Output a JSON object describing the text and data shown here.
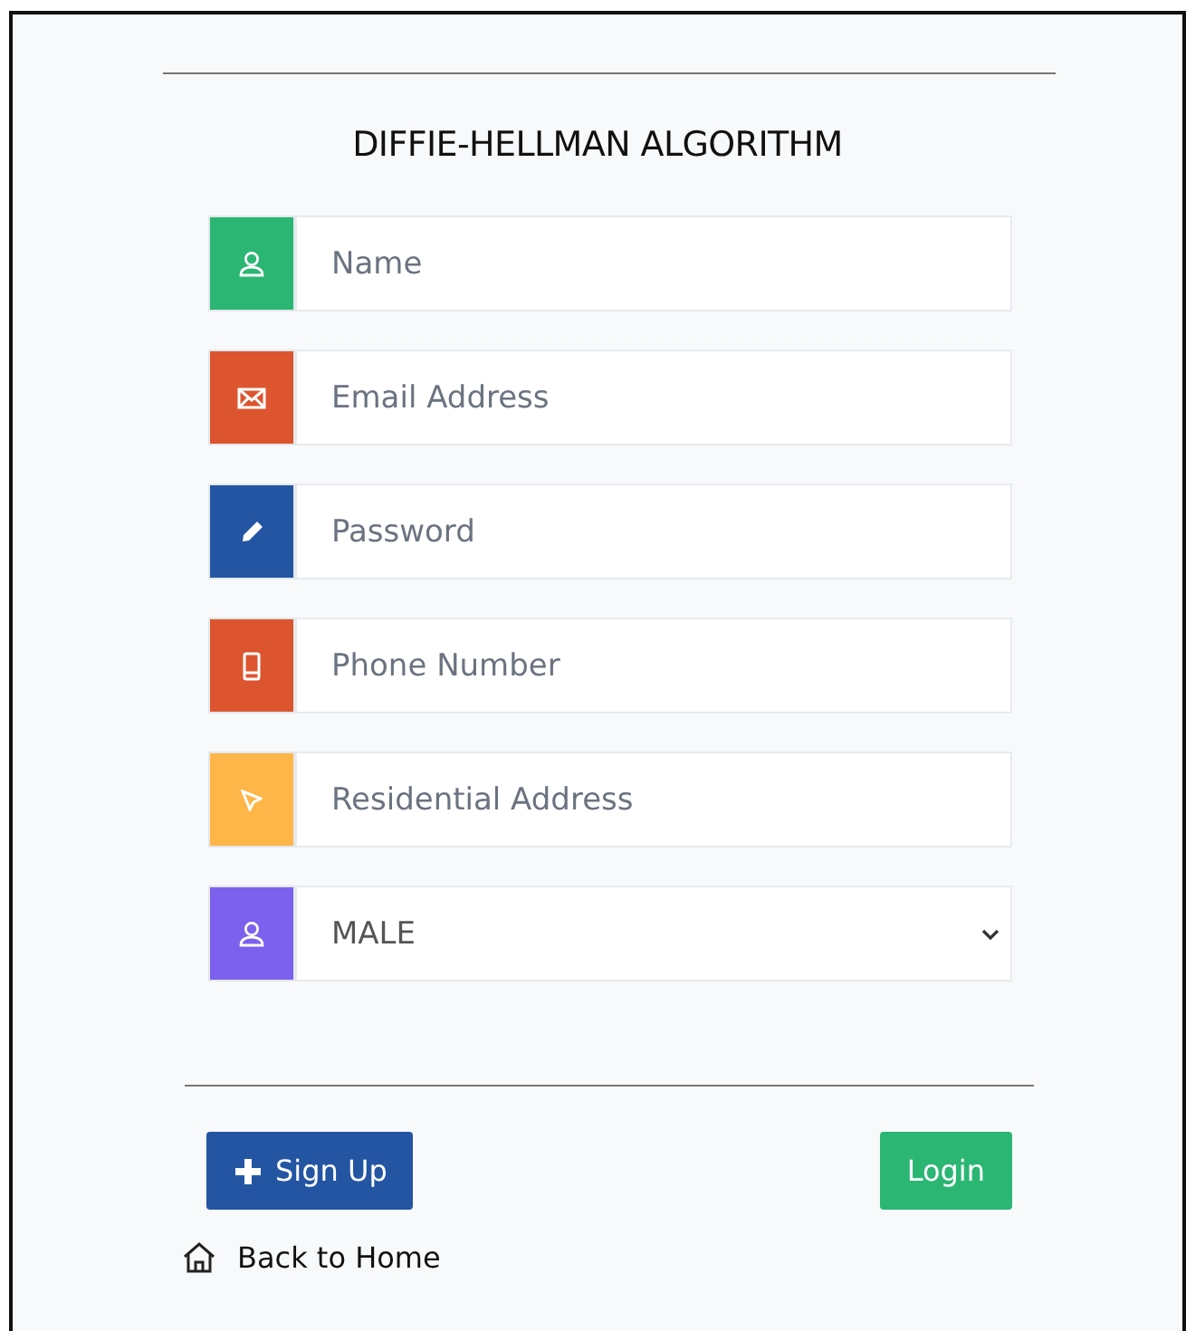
{
  "title": "DIFFIE-HELLMAN ALGORITHM",
  "fields": [
    {
      "kind": "person",
      "color": "#2bb673",
      "placeholder": "Name"
    },
    {
      "kind": "mail",
      "color": "#dc552f",
      "placeholder": "Email Address"
    },
    {
      "kind": "pencil",
      "color": "#2355a3",
      "placeholder": "Password"
    },
    {
      "kind": "phone",
      "color": "#dc552f",
      "placeholder": "Phone Number"
    },
    {
      "kind": "pointer",
      "color": "#ffb648",
      "placeholder": "Residential Address"
    },
    {
      "kind": "person",
      "color": "#7b61ee",
      "value": "MALE"
    }
  ],
  "signup_button": "Sign Up",
  "login_button": "Login",
  "back_link": "Back to Home"
}
